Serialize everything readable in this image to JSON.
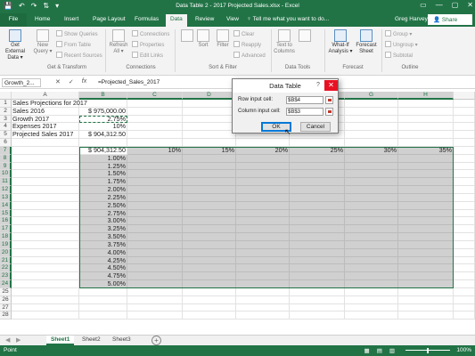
{
  "window": {
    "title": "Data Table 2 - 2017 Projected Sales.xlsx - Excel",
    "qat": [
      "💾",
      "↶",
      "↷",
      "⇅",
      "▾"
    ],
    "controls": [
      "▭",
      "—",
      "▢",
      "✕"
    ]
  },
  "ribbon_tabs": [
    {
      "label": "File"
    },
    {
      "label": "Home"
    },
    {
      "label": "Insert"
    },
    {
      "label": "Page Layout"
    },
    {
      "label": "Formulas"
    },
    {
      "label": "Data"
    },
    {
      "label": "Review"
    },
    {
      "label": "View"
    }
  ],
  "tell_me": "♀ Tell me what you want to do...",
  "user": "Greg Harvey",
  "share_label": "👤 Share",
  "ribbon": {
    "get_external": "Get External Data ▾",
    "new_query": "New Query ▾",
    "show_queries": "Show Queries",
    "from_table": "From Table",
    "recent_sources": "Recent Sources",
    "refresh_all": "Refresh All ▾",
    "connections": "Connections",
    "properties": "Properties",
    "edit_links": "Edit Links",
    "sort": "Sort",
    "filter": "Filter",
    "clear": "Clear",
    "reapply": "Reapply",
    "advanced": "Advanced",
    "text_to_columns": "Text to Columns",
    "what_if": "What-If Analysis ▾",
    "forecast_sheet": "Forecast Sheet",
    "group": "Group ▾",
    "ungroup": "Ungroup ▾",
    "subtotal": "Subtotal",
    "groups": [
      "Get & Transform",
      "Connections",
      "Sort & Filter",
      "Data Tools",
      "Forecast",
      "Outline"
    ]
  },
  "formula_bar": {
    "name_box": "Growth_2...",
    "icons": [
      "✕",
      "✓",
      "fx"
    ],
    "formula": "=Projected_Sales_2017"
  },
  "columns": [
    "A",
    "B",
    "C",
    "D",
    "E",
    "F",
    "G",
    "H"
  ],
  "rows": [
    "1",
    "2",
    "3",
    "4",
    "5",
    "6",
    "7",
    "8",
    "9",
    "10",
    "11",
    "12",
    "13",
    "14",
    "15",
    "16",
    "17",
    "18",
    "19",
    "20",
    "21",
    "22",
    "23",
    "24",
    "25",
    "26",
    "27",
    "28"
  ],
  "cells": {
    "A1": "Sales Projections for 2017",
    "A2": "Sales 2016",
    "B2": "$  975,000.00",
    "A3": "Growth 2017",
    "B3": "2.75%",
    "A4": "Expenses 2017",
    "B4": "10%",
    "A5": "Projected Sales 2017",
    "B5": "$  904,312.50",
    "B7": "$  904,312.50",
    "C7": "10%",
    "D7": "15%",
    "E7": "20%",
    "F7": "25%",
    "G7": "30%",
    "H7": "35%",
    "B8": "1.00%",
    "B9": "1.25%",
    "B10": "1.50%",
    "B11": "1.75%",
    "B12": "2.00%",
    "B13": "2.25%",
    "B14": "2.50%",
    "B15": "2.75%",
    "B16": "3.00%",
    "B17": "3.25%",
    "B18": "3.50%",
    "B19": "3.75%",
    "B20": "4.00%",
    "B21": "4.25%",
    "B22": "4.50%",
    "B23": "4.75%",
    "B24": "5.00%"
  },
  "dialog": {
    "title": "Data Table",
    "help": "?",
    "close": "✕",
    "row_label": "Row input cell:",
    "row_value": "$B$4",
    "col_label": "Column input cell:",
    "col_value": "$B$3",
    "ok": "OK",
    "cancel": "Cancel"
  },
  "sheets": {
    "nav": [
      "◀",
      "▶"
    ],
    "tabs": [
      "Sheet1",
      "Sheet2",
      "Sheet3"
    ],
    "active": "Sheet1",
    "add": "+"
  },
  "status": {
    "mode": "Point",
    "zoom": "100%",
    "views": [
      "▦",
      "▤",
      "▥"
    ]
  },
  "colors": {
    "accent": "#217346",
    "selection_fill": "#d0d0d0",
    "close_red": "#e81123"
  }
}
